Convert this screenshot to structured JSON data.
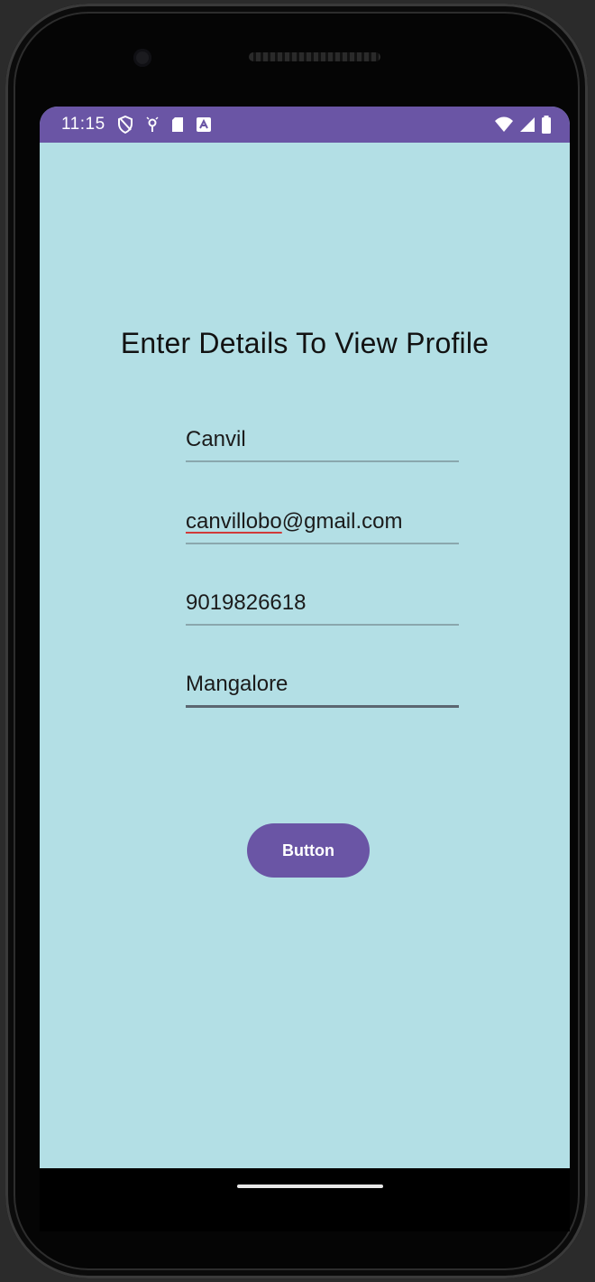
{
  "status_bar": {
    "time": "11:15",
    "left_icons": [
      "shield-icon",
      "location-icon",
      "sd-card-icon",
      "keyboard-icon"
    ],
    "right_icons": [
      "wifi-icon",
      "signal-icon",
      "battery-icon"
    ]
  },
  "form": {
    "title": "Enter Details To View Profile",
    "fields": [
      {
        "name": "name-field",
        "value": "Canvil"
      },
      {
        "name": "email-field",
        "value_prefix": "canvillobo",
        "value_suffix": "@gmail.com"
      },
      {
        "name": "phone-field",
        "value": "9019826618"
      },
      {
        "name": "city-field",
        "value": "Mangalore"
      }
    ],
    "button_label": "Button"
  },
  "colors": {
    "background": "#b3dfe5",
    "accent": "#6a55a5",
    "spell_check": "#d03a3a"
  }
}
